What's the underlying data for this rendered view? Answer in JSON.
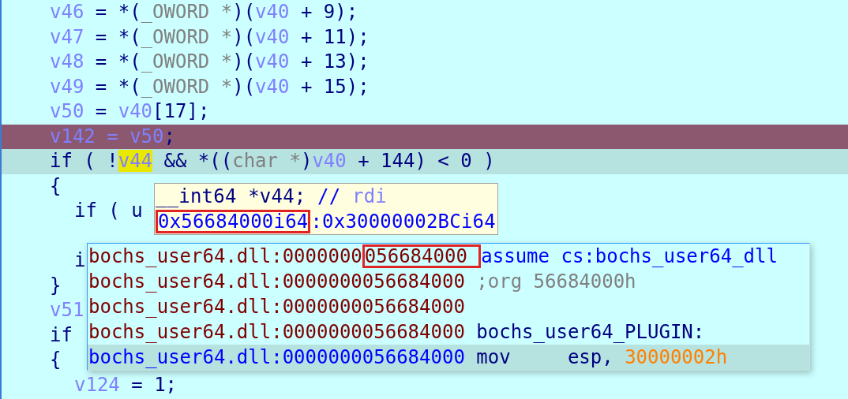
{
  "code_lines": [
    {
      "current": false,
      "selected": false,
      "tokens": [
        {
          "text": "v46",
          "kind": "var"
        },
        {
          "text": " = *(",
          "kind": "op"
        },
        {
          "text": "_OWORD *",
          "kind": "type"
        },
        {
          "text": ")(",
          "kind": "op"
        },
        {
          "text": "v40",
          "kind": "var"
        },
        {
          "text": " + 9);",
          "kind": "op"
        }
      ]
    },
    {
      "current": false,
      "selected": false,
      "tokens": [
        {
          "text": "v47",
          "kind": "var"
        },
        {
          "text": " = *(",
          "kind": "op"
        },
        {
          "text": "_OWORD *",
          "kind": "type"
        },
        {
          "text": ")(",
          "kind": "op"
        },
        {
          "text": "v40",
          "kind": "var"
        },
        {
          "text": " + 11);",
          "kind": "op"
        }
      ]
    },
    {
      "current": false,
      "selected": false,
      "tokens": [
        {
          "text": "v48",
          "kind": "var"
        },
        {
          "text": " = *(",
          "kind": "op"
        },
        {
          "text": "_OWORD *",
          "kind": "type"
        },
        {
          "text": ")(",
          "kind": "op"
        },
        {
          "text": "v40",
          "kind": "var"
        },
        {
          "text": " + 13);",
          "kind": "op"
        }
      ]
    },
    {
      "current": false,
      "selected": false,
      "tokens": [
        {
          "text": "v49",
          "kind": "var"
        },
        {
          "text": " = *(",
          "kind": "op"
        },
        {
          "text": "_OWORD *",
          "kind": "type"
        },
        {
          "text": ")(",
          "kind": "op"
        },
        {
          "text": "v40",
          "kind": "var"
        },
        {
          "text": " + 15);",
          "kind": "op"
        }
      ]
    },
    {
      "current": false,
      "selected": false,
      "tokens": [
        {
          "text": "v50",
          "kind": "var"
        },
        {
          "text": " = ",
          "kind": "op"
        },
        {
          "text": "v40",
          "kind": "var"
        },
        {
          "text": "[17];",
          "kind": "op"
        }
      ]
    },
    {
      "current": true,
      "selected": false,
      "tokens": [
        {
          "text": "v142",
          "kind": "var"
        },
        {
          "text": " = ",
          "kind": "var"
        },
        {
          "text": "v50",
          "kind": "var"
        },
        {
          "text": ";",
          "kind": "op"
        }
      ]
    },
    {
      "current": false,
      "selected": true,
      "tokens": [
        {
          "text": "if ( !",
          "kind": "op"
        },
        {
          "text": "v44",
          "kind": "match"
        },
        {
          "text": " && *((",
          "kind": "op"
        },
        {
          "text": "char *",
          "kind": "type"
        },
        {
          "text": ")",
          "kind": "op"
        },
        {
          "text": "v40",
          "kind": "var"
        },
        {
          "text": " + 144) < 0 )",
          "kind": "op"
        }
      ]
    },
    {
      "current": false,
      "selected": false,
      "tokens": [
        {
          "text": "{",
          "kind": "op"
        }
      ],
      "children": [
        {
          "current": false,
          "selected": false,
          "tokens": [
            {
              "text": "if ( u",
              "kind": "op"
            }
          ]
        },
        {
          "current": false,
          "selected": false,
          "tokens": [
            {
              "text": "i",
              "kind": "op"
            }
          ],
          "gap_before": true
        }
      ]
    },
    {
      "current": false,
      "selected": false,
      "tokens": [
        {
          "text": "}",
          "kind": "op"
        }
      ]
    },
    {
      "current": false,
      "selected": false,
      "tokens": [
        {
          "text": "v51",
          "kind": "var"
        }
      ]
    },
    {
      "current": false,
      "selected": false,
      "tokens": [
        {
          "text": "if",
          "kind": "op"
        }
      ]
    },
    {
      "current": false,
      "selected": false,
      "tokens": [
        {
          "text": "{",
          "kind": "op"
        }
      ],
      "children": [
        {
          "current": false,
          "selected": false,
          "tokens": [
            {
              "text": "v124",
              "kind": "var"
            },
            {
              "text": " = 1;",
              "kind": "op"
            }
          ]
        }
      ]
    }
  ],
  "hint": {
    "lines": [
      [
        {
          "text": "__int64 *v44; ",
          "kind": "op"
        },
        {
          "text": "// ",
          "kind": "comment"
        },
        {
          "text": "rdi",
          "kind": "var"
        }
      ],
      [
        {
          "text": "0x56684000i64",
          "kind": "addr",
          "boxed": true
        },
        {
          "text": ":0x30000002BCi64",
          "kind": "addr"
        }
      ]
    ]
  },
  "disasm_popup": {
    "rows": [
      {
        "selected": false,
        "tokens": [
          {
            "text": "bochs_user64.dll:0000000",
            "kind": "seg"
          },
          {
            "text": "056684000 ",
            "kind": "seg",
            "boxed": true
          },
          {
            "text": "assume cs:bochs_user64_dll",
            "kind": "keyword"
          }
        ]
      },
      {
        "selected": false,
        "tokens": [
          {
            "text": "bochs_user64.dll:0000000056684000 ",
            "kind": "seg"
          },
          {
            "text": ";org 56684000h",
            "kind": "comment2"
          }
        ]
      },
      {
        "selected": false,
        "tokens": [
          {
            "text": "bochs_user64.dll:0000000056684000",
            "kind": "seg"
          }
        ]
      },
      {
        "selected": false,
        "tokens": [
          {
            "text": "bochs_user64.dll:0000000056684000 ",
            "kind": "seg"
          },
          {
            "text": "bochs_user64_PLUGIN:",
            "kind": "op"
          }
        ]
      },
      {
        "selected": true,
        "tokens": [
          {
            "text": "bochs_user64.dll:0000000056684000 ",
            "kind": "seg"
          },
          {
            "text": "mov     esp, ",
            "kind": "op"
          },
          {
            "text": "30000002h",
            "kind": "imm"
          }
        ]
      }
    ]
  }
}
